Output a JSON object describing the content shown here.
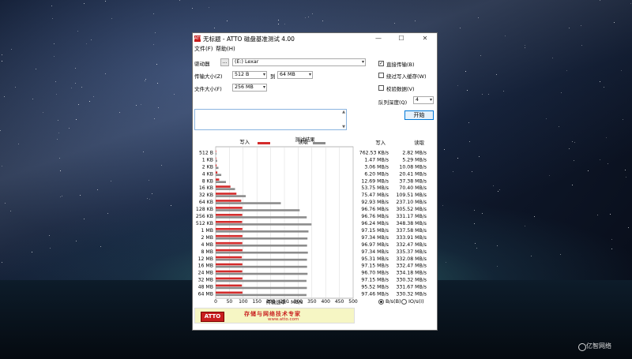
{
  "window": {
    "title": "无标题 - ATTO 磁盘基准测试 4.00",
    "app_icon_text": "ATTO",
    "controls": {
      "minimize": "—",
      "maximize": "☐",
      "close": "✕"
    }
  },
  "menu": {
    "file": "文件(F)",
    "help": "帮助(H)"
  },
  "settings": {
    "drive_label": "驱动器",
    "browse_label": "...",
    "drive_value": "(E:) Lexar",
    "transfer_label": "传输大小(Z)",
    "transfer_from": "512 B",
    "transfer_to_label": "到",
    "transfer_to": "64 MB",
    "file_size_label": "文件大小(F)",
    "file_size": "256 MB",
    "direct_io_label": "直接传输(B)",
    "direct_io_checked": true,
    "bypass_write_label": "绕过写入缓存(W)",
    "verify_label": "校验数据(V)",
    "queue_label": "队列深度(Q)",
    "queue_value": "4",
    "start_label": "开始"
  },
  "results": {
    "header": "测试结果",
    "write_legend": "写入",
    "read_legend": "读取",
    "write_col": "写入",
    "read_col": "读取",
    "axis_label": "传输速率 - MB/s",
    "unit_bytes": "B/s(B)",
    "unit_io": "IO/s(I)"
  },
  "colors": {
    "write": "#d42b2b",
    "read": "#8c8c8c"
  },
  "banner": {
    "logo": "ATTO",
    "slogan": "存储与网络技术专家",
    "url": "www.atto.com"
  },
  "watermark": "亿智网络",
  "chart_data": {
    "type": "bar",
    "orientation": "horizontal",
    "categories": [
      "512 B",
      "1 KB",
      "2 KB",
      "4 KB",
      "8 KB",
      "16 KB",
      "32 KB",
      "64 KB",
      "128 KB",
      "256 KB",
      "512 KB",
      "1 MB",
      "2 MB",
      "4 MB",
      "8 MB",
      "12 MB",
      "16 MB",
      "24 MB",
      "32 MB",
      "48 MB",
      "64 MB"
    ],
    "series": [
      {
        "name": "写入",
        "values": [
          0.76253,
          1.47,
          3.06,
          6.2,
          12.69,
          53.75,
          75.47,
          92.93,
          96.76,
          96.76,
          96.24,
          97.15,
          97.34,
          96.97,
          97.34,
          95.31,
          97.15,
          96.7,
          97.15,
          95.52,
          97.46
        ],
        "labels": [
          "762.53 KB/s",
          "1.47 MB/s",
          "3.06 MB/s",
          "6.20 MB/s",
          "12.69 MB/s",
          "53.75 MB/s",
          "75.47 MB/s",
          "92.93 MB/s",
          "96.76 MB/s",
          "96.76 MB/s",
          "96.24 MB/s",
          "97.15 MB/s",
          "97.34 MB/s",
          "96.97 MB/s",
          "97.34 MB/s",
          "95.31 MB/s",
          "97.15 MB/s",
          "96.70 MB/s",
          "97.15 MB/s",
          "95.52 MB/s",
          "97.46 MB/s"
        ]
      },
      {
        "name": "读取",
        "values": [
          2.82,
          5.29,
          10.08,
          20.41,
          37.38,
          70.4,
          109.51,
          237.1,
          305.52,
          331.17,
          348.38,
          337.58,
          333.91,
          332.47,
          335.37,
          332.08,
          332.47,
          334.18,
          330.32,
          331.67,
          330.32
        ],
        "labels": [
          "2.82 MB/s",
          "5.29 MB/s",
          "10.08 MB/s",
          "20.41 MB/s",
          "37.38 MB/s",
          "70.40 MB/s",
          "109.51 MB/s",
          "237.10 MB/s",
          "305.52 MB/s",
          "331.17 MB/s",
          "348.38 MB/s",
          "337.58 MB/s",
          "333.91 MB/s",
          "332.47 MB/s",
          "335.37 MB/s",
          "332.08 MB/s",
          "332.47 MB/s",
          "334.18 MB/s",
          "330.32 MB/s",
          "331.67 MB/s",
          "330.32 MB/s"
        ]
      }
    ],
    "xlabel": "传输速率 - MB/s",
    "xlim": [
      0,
      500
    ],
    "xticks": [
      0,
      50,
      100,
      150,
      200,
      250,
      300,
      350,
      400,
      450,
      500
    ],
    "grid": true,
    "legend": "top"
  }
}
